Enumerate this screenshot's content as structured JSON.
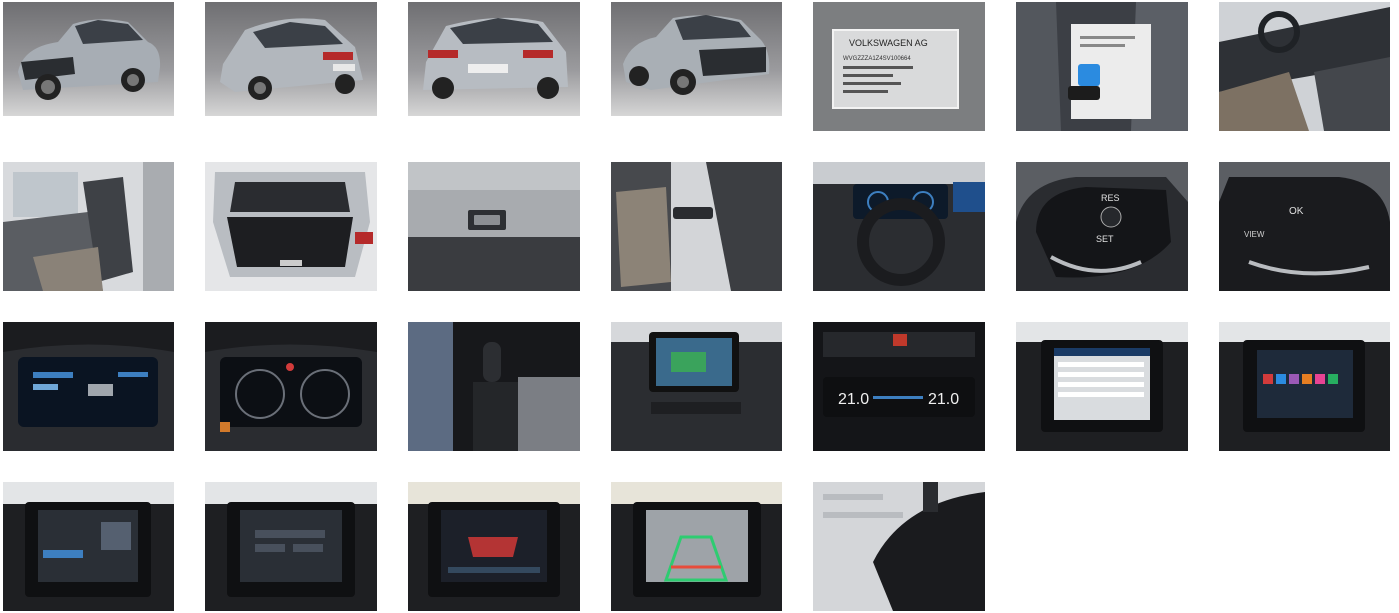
{
  "gallery": {
    "photos": [
      {
        "subject": "front-left exterior"
      },
      {
        "subject": "rear-left exterior"
      },
      {
        "subject": "rear exterior"
      },
      {
        "subject": "front-left exterior"
      },
      {
        "subject": "vin plate",
        "lines": [
          "VOLKSWAGEN AG",
          "WVGZZZA1Z4SV100664"
        ]
      },
      {
        "subject": "keys and papers on seat"
      },
      {
        "subject": "front cabin"
      },
      {
        "subject": "rear seats"
      },
      {
        "subject": "open trunk"
      },
      {
        "subject": "tailgate button"
      },
      {
        "subject": "front seats"
      },
      {
        "subject": "steering wheel and dash"
      },
      {
        "subject": "steering wheel left controls",
        "buttons": [
          "RES",
          "SET"
        ]
      },
      {
        "subject": "steering wheel right controls",
        "buttons": [
          "OK",
          "VIEW"
        ]
      },
      {
        "subject": "digital cockpit"
      },
      {
        "subject": "digital cockpit"
      },
      {
        "subject": "gear shifter"
      },
      {
        "subject": "infotainment screen"
      },
      {
        "subject": "climate controls",
        "readouts": [
          "21.0",
          "21.0"
        ]
      },
      {
        "subject": "infotainment settings"
      },
      {
        "subject": "infotainment menu"
      },
      {
        "subject": "infotainment bluetooth"
      },
      {
        "subject": "infotainment phone"
      },
      {
        "subject": "infotainment car settings"
      },
      {
        "subject": "rear view camera"
      },
      {
        "subject": "rear view mirror"
      }
    ]
  }
}
